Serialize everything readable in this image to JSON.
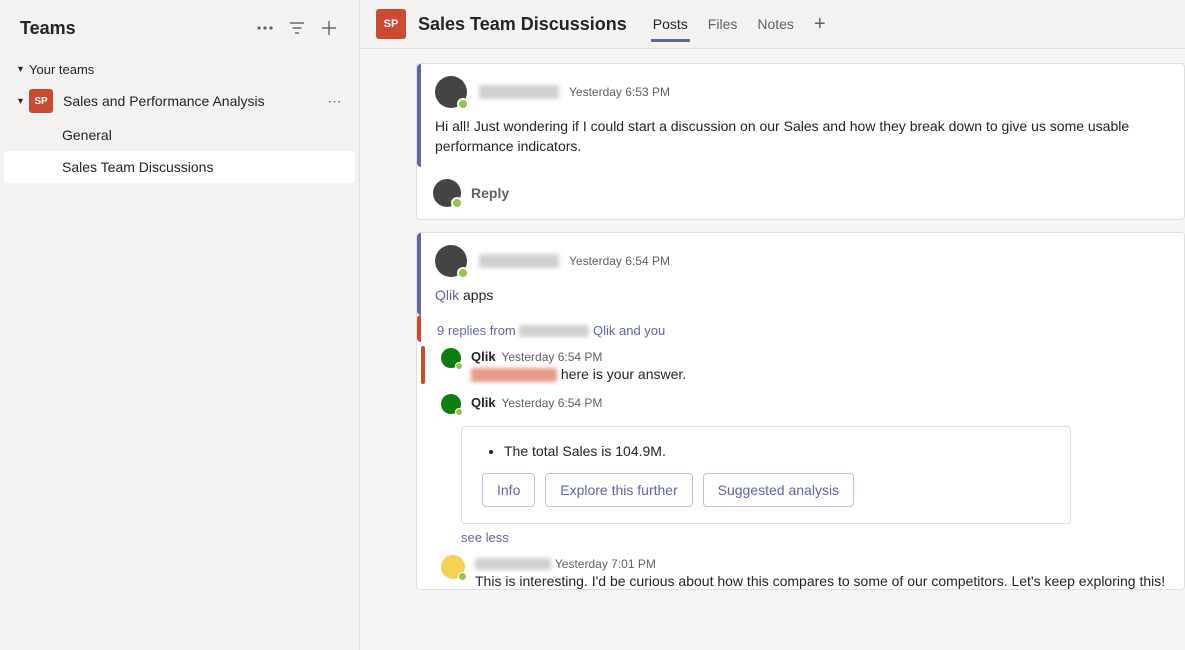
{
  "sidebar": {
    "title": "Teams",
    "section_label": "Your teams",
    "team": {
      "avatar_text": "SP",
      "name": "Sales and Performance Analysis"
    },
    "channels": [
      {
        "label": "General",
        "active": false
      },
      {
        "label": "Sales Team Discussions",
        "active": true
      }
    ]
  },
  "header": {
    "avatar_text": "SP",
    "title": "Sales Team Discussions",
    "tabs": {
      "posts": "Posts",
      "files": "Files",
      "notes": "Notes"
    }
  },
  "posts": {
    "first": {
      "timestamp": "Yesterday 6:53 PM",
      "body": "Hi all! Just wondering if I could start a discussion on our Sales and how they break down to give us some usable performance indicators.",
      "reply_label": "Reply"
    },
    "second": {
      "timestamp": "Yesterday 6:54 PM",
      "link_word": "Qlik",
      "rest": " apps",
      "thread_summary_a": "9 replies from ",
      "thread_summary_b": " Qlik and you",
      "replies": {
        "r1": {
          "name": "Qlik",
          "timestamp": "Yesterday 6:54 PM",
          "body_rest": " here is your answer."
        },
        "r2": {
          "name": "Qlik",
          "timestamp": "Yesterday 6:54 PM",
          "answer_text": "The total Sales is 104.9M.",
          "buttons": {
            "info": "Info",
            "explore": "Explore this further",
            "suggested": "Suggested analysis"
          },
          "see_less": "see less"
        },
        "r3": {
          "timestamp": "Yesterday 7:01 PM",
          "body": "This is interesting. I'd be curious about how this compares to some of our competitors. Let's keep exploring this!"
        }
      }
    }
  }
}
